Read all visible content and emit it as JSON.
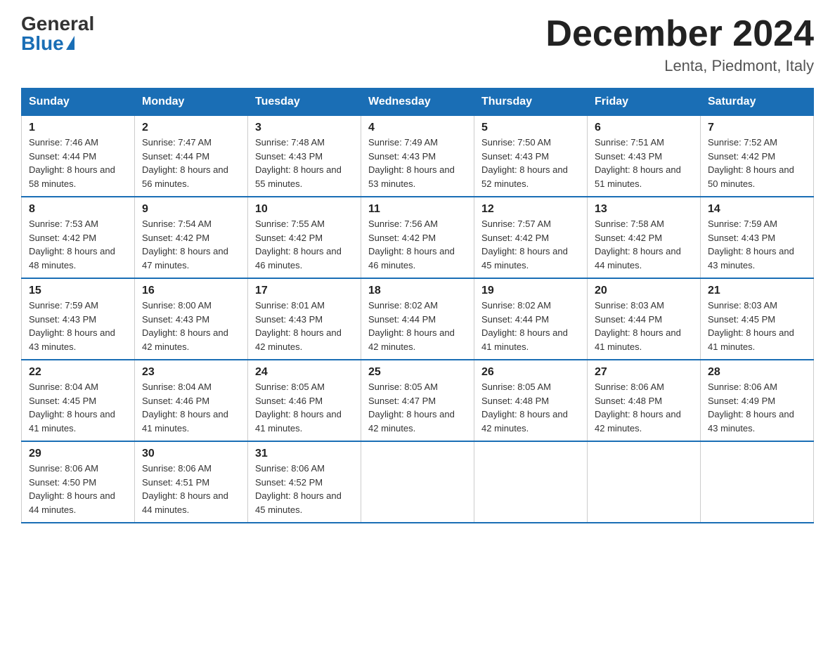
{
  "header": {
    "logo_general": "General",
    "logo_blue": "Blue",
    "month_title": "December 2024",
    "location": "Lenta, Piedmont, Italy"
  },
  "days_of_week": [
    "Sunday",
    "Monday",
    "Tuesday",
    "Wednesday",
    "Thursday",
    "Friday",
    "Saturday"
  ],
  "weeks": [
    [
      {
        "day": "1",
        "sunrise": "7:46 AM",
        "sunset": "4:44 PM",
        "daylight": "8 hours and 58 minutes."
      },
      {
        "day": "2",
        "sunrise": "7:47 AM",
        "sunset": "4:44 PM",
        "daylight": "8 hours and 56 minutes."
      },
      {
        "day": "3",
        "sunrise": "7:48 AM",
        "sunset": "4:43 PM",
        "daylight": "8 hours and 55 minutes."
      },
      {
        "day": "4",
        "sunrise": "7:49 AM",
        "sunset": "4:43 PM",
        "daylight": "8 hours and 53 minutes."
      },
      {
        "day": "5",
        "sunrise": "7:50 AM",
        "sunset": "4:43 PM",
        "daylight": "8 hours and 52 minutes."
      },
      {
        "day": "6",
        "sunrise": "7:51 AM",
        "sunset": "4:43 PM",
        "daylight": "8 hours and 51 minutes."
      },
      {
        "day": "7",
        "sunrise": "7:52 AM",
        "sunset": "4:42 PM",
        "daylight": "8 hours and 50 minutes."
      }
    ],
    [
      {
        "day": "8",
        "sunrise": "7:53 AM",
        "sunset": "4:42 PM",
        "daylight": "8 hours and 48 minutes."
      },
      {
        "day": "9",
        "sunrise": "7:54 AM",
        "sunset": "4:42 PM",
        "daylight": "8 hours and 47 minutes."
      },
      {
        "day": "10",
        "sunrise": "7:55 AM",
        "sunset": "4:42 PM",
        "daylight": "8 hours and 46 minutes."
      },
      {
        "day": "11",
        "sunrise": "7:56 AM",
        "sunset": "4:42 PM",
        "daylight": "8 hours and 46 minutes."
      },
      {
        "day": "12",
        "sunrise": "7:57 AM",
        "sunset": "4:42 PM",
        "daylight": "8 hours and 45 minutes."
      },
      {
        "day": "13",
        "sunrise": "7:58 AM",
        "sunset": "4:42 PM",
        "daylight": "8 hours and 44 minutes."
      },
      {
        "day": "14",
        "sunrise": "7:59 AM",
        "sunset": "4:43 PM",
        "daylight": "8 hours and 43 minutes."
      }
    ],
    [
      {
        "day": "15",
        "sunrise": "7:59 AM",
        "sunset": "4:43 PM",
        "daylight": "8 hours and 43 minutes."
      },
      {
        "day": "16",
        "sunrise": "8:00 AM",
        "sunset": "4:43 PM",
        "daylight": "8 hours and 42 minutes."
      },
      {
        "day": "17",
        "sunrise": "8:01 AM",
        "sunset": "4:43 PM",
        "daylight": "8 hours and 42 minutes."
      },
      {
        "day": "18",
        "sunrise": "8:02 AM",
        "sunset": "4:44 PM",
        "daylight": "8 hours and 42 minutes."
      },
      {
        "day": "19",
        "sunrise": "8:02 AM",
        "sunset": "4:44 PM",
        "daylight": "8 hours and 41 minutes."
      },
      {
        "day": "20",
        "sunrise": "8:03 AM",
        "sunset": "4:44 PM",
        "daylight": "8 hours and 41 minutes."
      },
      {
        "day": "21",
        "sunrise": "8:03 AM",
        "sunset": "4:45 PM",
        "daylight": "8 hours and 41 minutes."
      }
    ],
    [
      {
        "day": "22",
        "sunrise": "8:04 AM",
        "sunset": "4:45 PM",
        "daylight": "8 hours and 41 minutes."
      },
      {
        "day": "23",
        "sunrise": "8:04 AM",
        "sunset": "4:46 PM",
        "daylight": "8 hours and 41 minutes."
      },
      {
        "day": "24",
        "sunrise": "8:05 AM",
        "sunset": "4:46 PM",
        "daylight": "8 hours and 41 minutes."
      },
      {
        "day": "25",
        "sunrise": "8:05 AM",
        "sunset": "4:47 PM",
        "daylight": "8 hours and 42 minutes."
      },
      {
        "day": "26",
        "sunrise": "8:05 AM",
        "sunset": "4:48 PM",
        "daylight": "8 hours and 42 minutes."
      },
      {
        "day": "27",
        "sunrise": "8:06 AM",
        "sunset": "4:48 PM",
        "daylight": "8 hours and 42 minutes."
      },
      {
        "day": "28",
        "sunrise": "8:06 AM",
        "sunset": "4:49 PM",
        "daylight": "8 hours and 43 minutes."
      }
    ],
    [
      {
        "day": "29",
        "sunrise": "8:06 AM",
        "sunset": "4:50 PM",
        "daylight": "8 hours and 44 minutes."
      },
      {
        "day": "30",
        "sunrise": "8:06 AM",
        "sunset": "4:51 PM",
        "daylight": "8 hours and 44 minutes."
      },
      {
        "day": "31",
        "sunrise": "8:06 AM",
        "sunset": "4:52 PM",
        "daylight": "8 hours and 45 minutes."
      },
      null,
      null,
      null,
      null
    ]
  ]
}
